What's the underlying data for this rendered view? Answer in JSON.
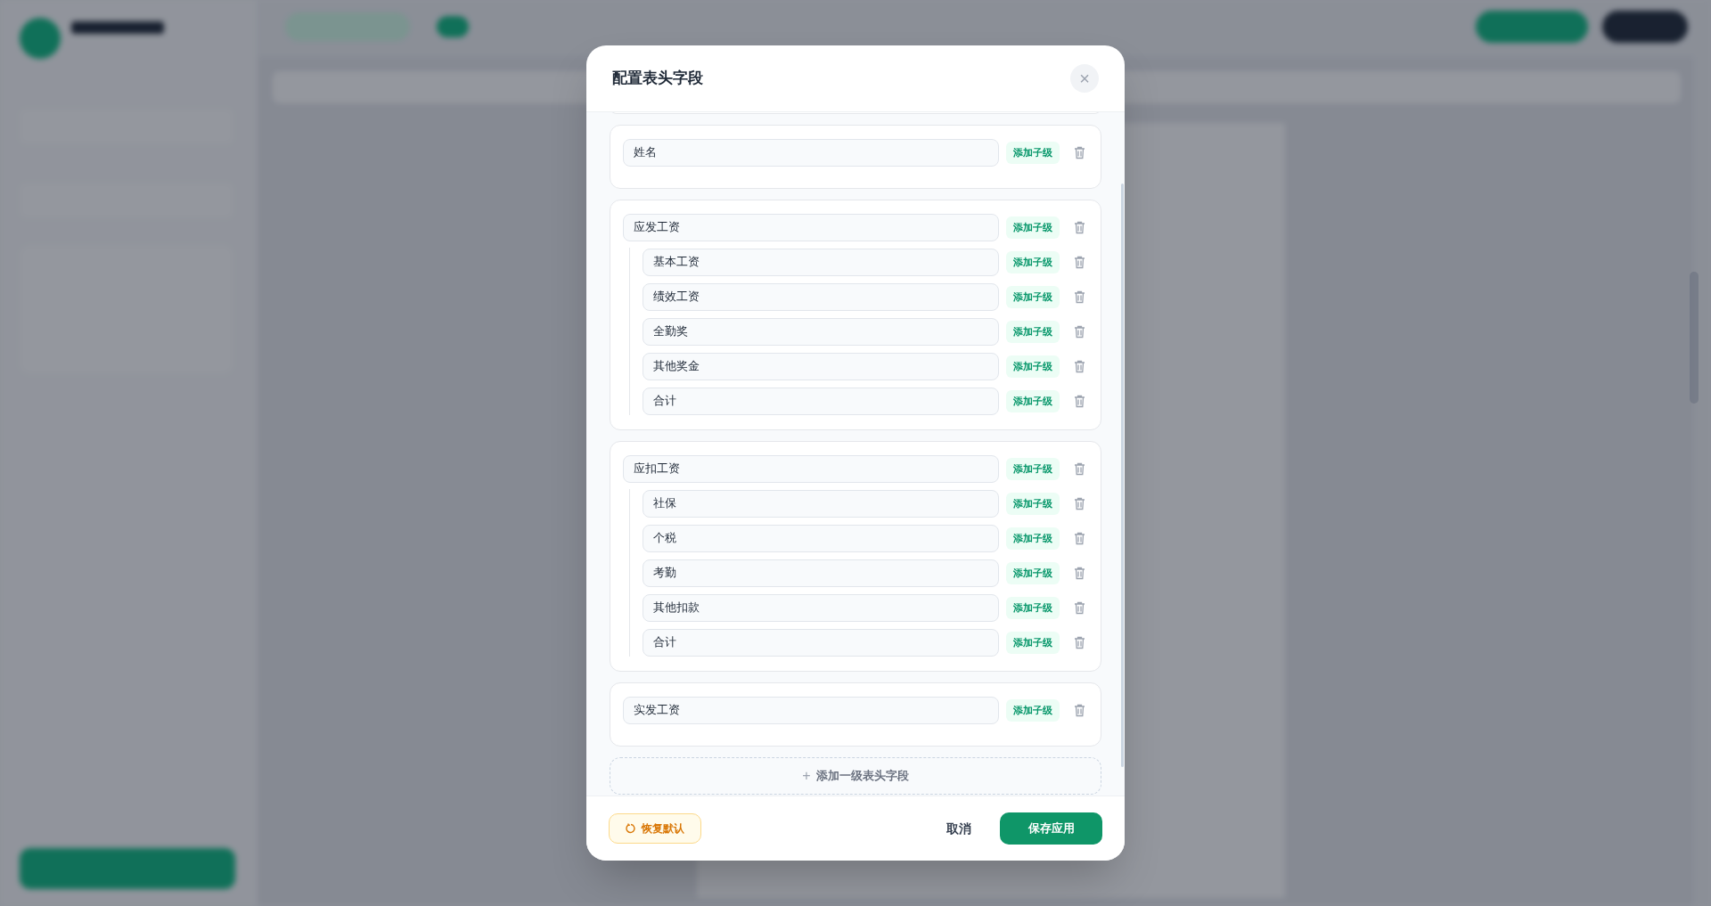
{
  "dialog": {
    "title": "配置表头字段",
    "close": "×",
    "fields": [
      {
        "value": "姓名",
        "add_child": "添加子级"
      },
      {
        "value": "应发工资",
        "add_child": "添加子级",
        "children": [
          {
            "value": "基本工资",
            "add_child": "添加子级"
          },
          {
            "value": "绩效工资",
            "add_child": "添加子级"
          },
          {
            "value": "全勤奖",
            "add_child": "添加子级"
          },
          {
            "value": "其他奖金",
            "add_child": "添加子级"
          },
          {
            "value": "合计",
            "add_child": "添加子级"
          }
        ]
      },
      {
        "value": "应扣工资",
        "add_child": "添加子级",
        "children": [
          {
            "value": "社保",
            "add_child": "添加子级"
          },
          {
            "value": "个税",
            "add_child": "添加子级"
          },
          {
            "value": "考勤",
            "add_child": "添加子级"
          },
          {
            "value": "其他扣款",
            "add_child": "添加子级"
          },
          {
            "value": "合计",
            "add_child": "添加子级"
          }
        ]
      },
      {
        "value": "实发工资",
        "add_child": "添加子级"
      }
    ],
    "add_top_level": {
      "icon": "+",
      "label": "添加一级表头字段"
    },
    "footer": {
      "reset": "恢复默认",
      "cancel": "取消",
      "save": "保存应用"
    }
  }
}
